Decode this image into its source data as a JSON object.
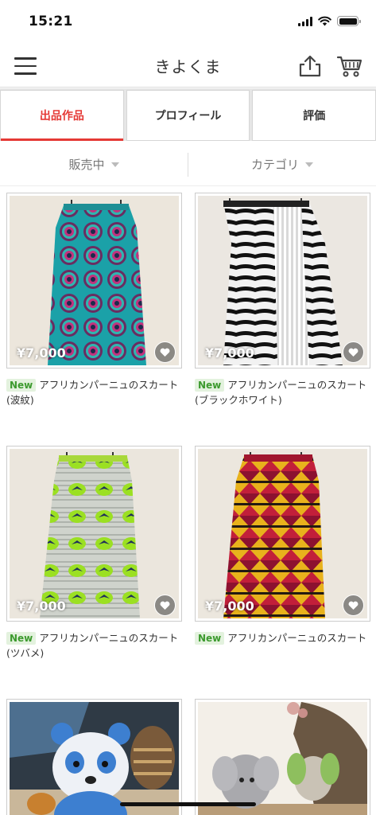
{
  "status_bar": {
    "time": "15:21"
  },
  "header": {
    "title": "きよくま",
    "menu_icon": "hamburger-icon",
    "share_icon": "share-icon",
    "cart_icon": "cart-icon"
  },
  "tabs": [
    {
      "label": "出品作品",
      "active": true
    },
    {
      "label": "プロフィール",
      "active": false
    },
    {
      "label": "評価",
      "active": false
    }
  ],
  "filters": {
    "status": "販売中",
    "category": "カテゴリ"
  },
  "colors": {
    "accent": "#e53935",
    "badge_bg": "#e3f2de",
    "badge_text": "#3c9a2e"
  },
  "products": [
    {
      "price": "¥7,000",
      "badge": "New",
      "title": "アフリカンパーニュのスカート(波紋)"
    },
    {
      "price": "¥7,000",
      "badge": "New",
      "title": "アフリカンパーニュのスカート(ブラックホワイト)"
    },
    {
      "price": "¥7,000",
      "badge": "New",
      "title": "アフリカンパーニュのスカート(ツバメ)"
    },
    {
      "price": "¥7,000",
      "badge": "New",
      "title": "アフリカンパーニュのスカート"
    }
  ]
}
